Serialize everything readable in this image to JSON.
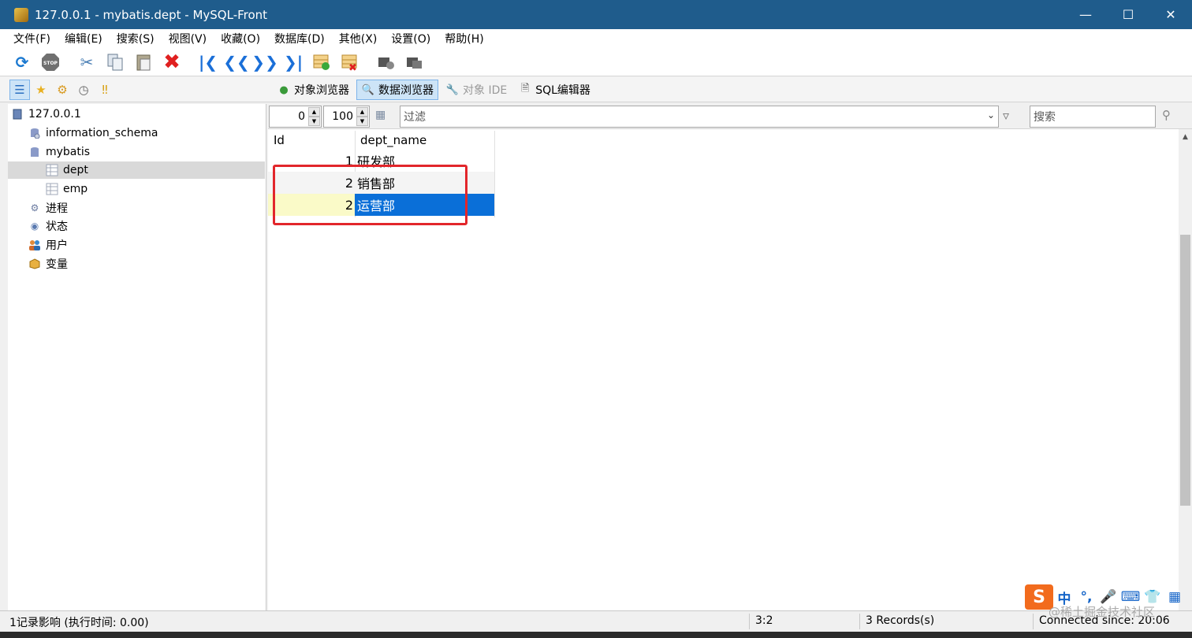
{
  "window": {
    "title": "127.0.0.1 - mybatis.dept - MySQL-Front"
  },
  "menu": [
    "文件(F)",
    "编辑(E)",
    "搜索(S)",
    "视图(V)",
    "收藏(O)",
    "数据库(D)",
    "其他(X)",
    "设置(O)",
    "帮助(H)"
  ],
  "toolbar_icons": [
    "refresh-icon",
    "stop-icon",
    "cut-icon",
    "copy-icon",
    "paste-icon",
    "delete-icon",
    "first-record-icon",
    "prev-record-icon",
    "next-record-icon",
    "last-record-icon",
    "insert-record-icon",
    "delete-record-icon",
    "post-icon",
    "cancel-icon"
  ],
  "view_tabs": [
    {
      "label": "对象浏览器",
      "active": false,
      "disabled": false
    },
    {
      "label": "数据浏览器",
      "active": true,
      "disabled": false
    },
    {
      "label": "对象 IDE",
      "active": false,
      "disabled": true
    },
    {
      "label": "SQL编辑器",
      "active": false,
      "disabled": false
    }
  ],
  "tree": {
    "server": "127.0.0.1",
    "db_info": "information_schema",
    "db_mybatis": "mybatis",
    "table_dept": "dept",
    "table_emp": "emp",
    "processes": "进程",
    "status": "状态",
    "users": "用户",
    "variables": "变量"
  },
  "filter": {
    "offset": "0",
    "limit": "100",
    "filter_placeholder": "过滤",
    "search_placeholder": "搜索"
  },
  "grid": {
    "columns": [
      "Id",
      "dept_name"
    ],
    "rows": [
      {
        "id": "1",
        "name": "研发部"
      },
      {
        "id": "2",
        "name": "销售部"
      },
      {
        "id": "2",
        "name": "运营部"
      }
    ]
  },
  "status": {
    "message": "1记录影响  (执行时间: 0.00)",
    "position": "3:2",
    "records": "3 Records(s)",
    "connected": "Connected since: 20:06"
  },
  "ime": {
    "logo": "S",
    "mode": "中"
  },
  "watermark": "@稀土掘金技术社区"
}
